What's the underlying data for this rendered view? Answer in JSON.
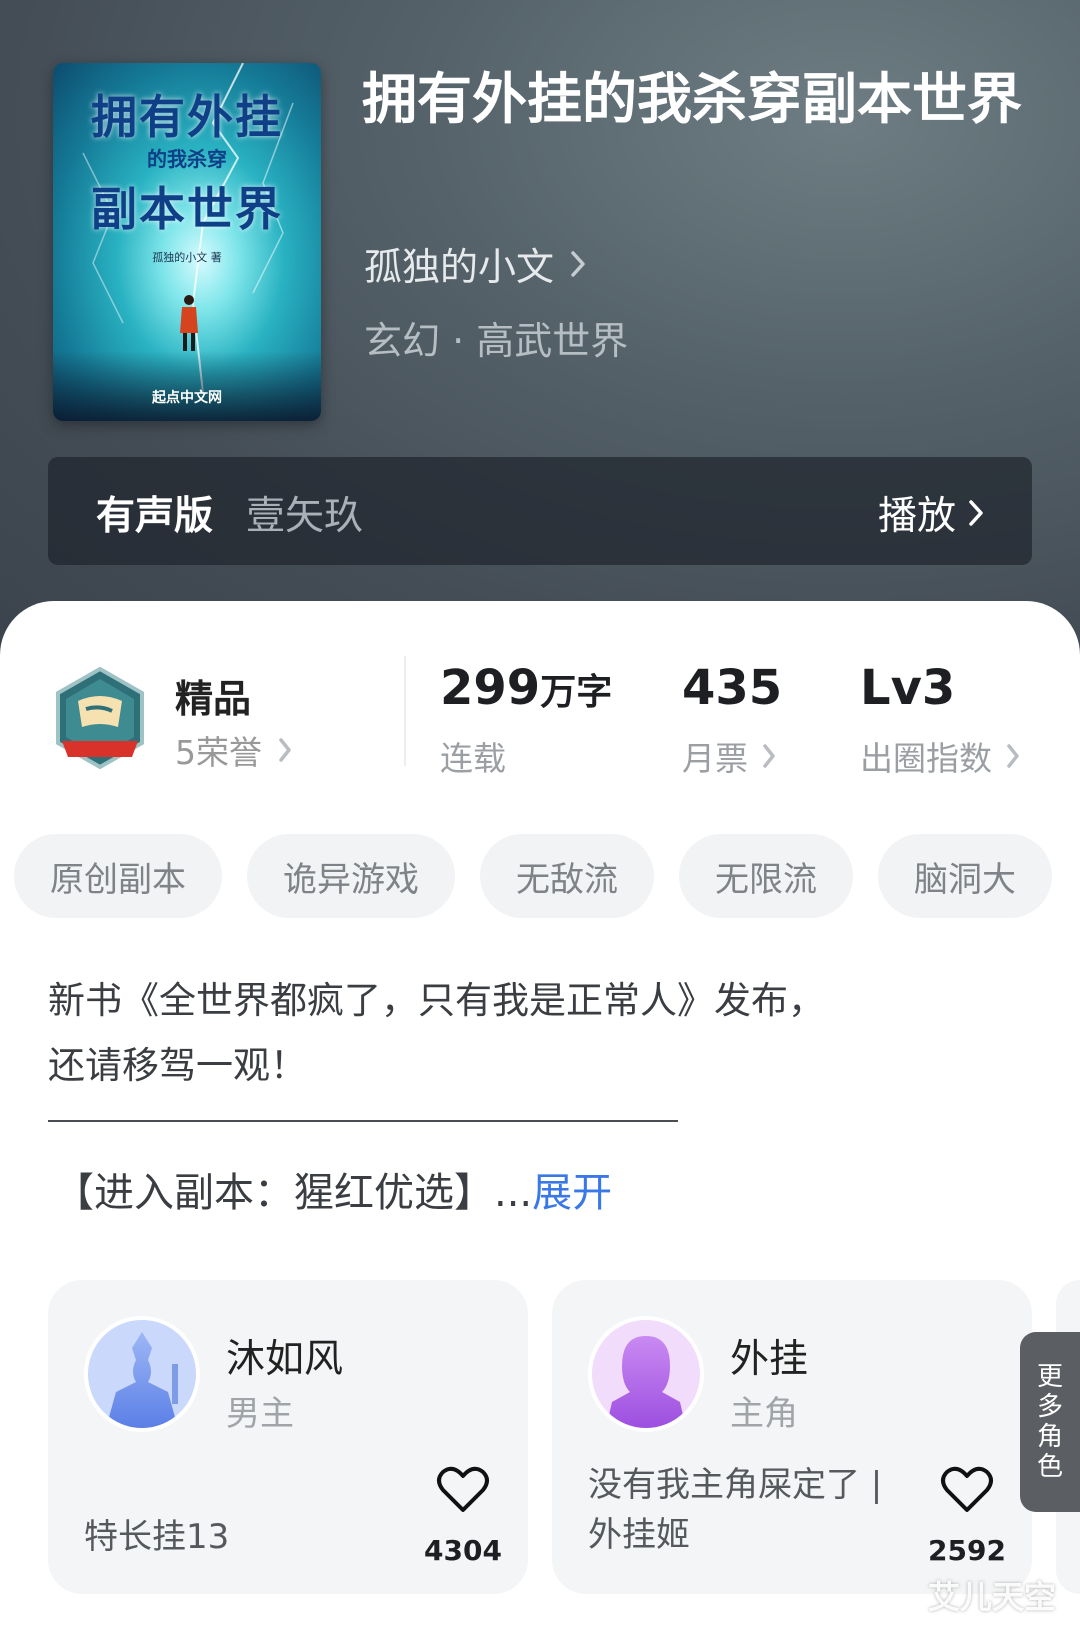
{
  "book": {
    "title": "拥有外挂的我杀穿副本世界",
    "author": "孤独的小文",
    "genre": "玄幻 · 高武世界"
  },
  "cover": {
    "line1": "拥有外挂",
    "line2": "的我杀穿",
    "line3": "副本世界",
    "author_text": "孤独的小文 著",
    "publisher": "起点中文网"
  },
  "audio": {
    "label": "有声版",
    "narrator": "壹矢玖",
    "play_label": "播放"
  },
  "honor": {
    "badge_text": "万人追捧",
    "title": "精品",
    "subtitle": "5荣誉"
  },
  "stats": {
    "words_value": "299",
    "words_unit": "万字",
    "words_label": "连载",
    "votes_value": "435",
    "votes_label": "月票",
    "level_value": "Lv3",
    "level_label": "出圈指数"
  },
  "tags": [
    "原创副本",
    "诡异游戏",
    "无敌流",
    "无限流",
    "脑洞大"
  ],
  "description": {
    "line1": "新书《全世界都疯了，只有我是正常人》发布，",
    "line2": "还请移驾一观！",
    "line3": "【进入副本：猩红优选】...",
    "expand": "展开"
  },
  "characters": [
    {
      "name": "沐如风",
      "role": "男主",
      "desc": "特长挂13",
      "likes": "4304"
    },
    {
      "name": "外挂",
      "role": "主角",
      "desc_line1": "没有我主角屎定了 |",
      "desc_line2": "外挂姬",
      "likes": "2592"
    }
  ],
  "more_roles": [
    "更",
    "多",
    "角",
    "色"
  ],
  "watermark": "艾儿天空",
  "colors": {
    "header_bg": "#4a535c",
    "link_blue": "#3b78e7",
    "tag_bg": "#f2f3f5",
    "card_bg": "#f4f5f6"
  }
}
